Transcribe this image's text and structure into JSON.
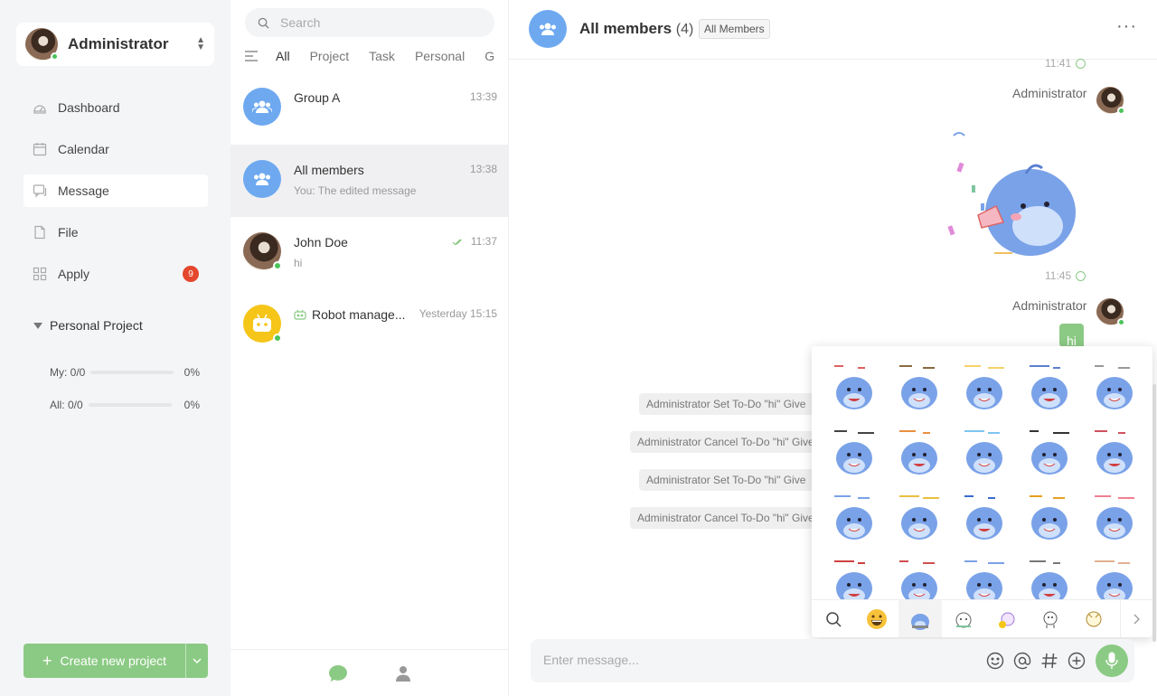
{
  "user": {
    "name": "Administrator"
  },
  "nav": [
    {
      "label": "Dashboard",
      "icon": "dashboard-icon"
    },
    {
      "label": "Calendar",
      "icon": "calendar-icon"
    },
    {
      "label": "Message",
      "icon": "message-icon"
    },
    {
      "label": "File",
      "icon": "file-icon"
    },
    {
      "label": "Apply",
      "icon": "apply-icon",
      "badge": "9"
    }
  ],
  "project": {
    "heading": "Personal Project",
    "my": {
      "label": "My: 0/0",
      "pct": "0%"
    },
    "all": {
      "label": "All: 0/0",
      "pct": "0%"
    }
  },
  "create_button": "Create new project",
  "search": {
    "placeholder": "Search"
  },
  "filters": [
    "All",
    "Project",
    "Task",
    "Personal",
    "G"
  ],
  "conversations": [
    {
      "name": "Group A",
      "time": "13:39",
      "msg": ""
    },
    {
      "name": "All members",
      "time": "13:38",
      "msg": "You: The edited message"
    },
    {
      "name": "John Doe",
      "time": "11:37",
      "msg": "hi"
    },
    {
      "name": "Robot manage...",
      "time": "Yesterday 15:15",
      "msg": ""
    }
  ],
  "chat": {
    "title": "All members",
    "count": "(4)",
    "tag": "All Members",
    "time1": "11:41",
    "time2": "11:45",
    "sender": "Administrator",
    "bubble": "hi",
    "system": [
      "Administrator Set To-Do \"hi\" Give",
      "Administrator Cancel To-Do \"hi\" Give",
      "Administrator Set To-Do \"hi\" Give",
      "Administrator Cancel To-Do \"hi\" Give"
    ],
    "input_placeholder": "Enter message..."
  },
  "colors": {
    "accent": "#8bca84",
    "group_avatar": "#6ea9f0",
    "badge": "#e4472d",
    "robot": "#f5c518"
  }
}
